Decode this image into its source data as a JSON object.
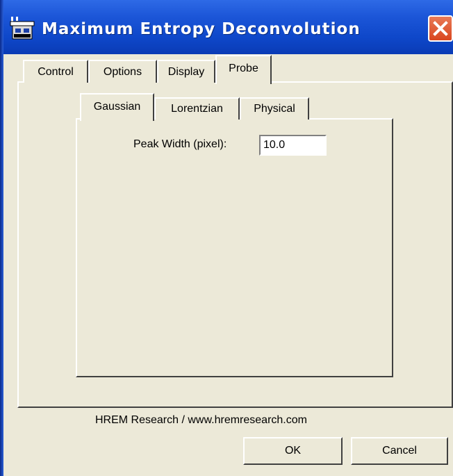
{
  "window": {
    "title": "Maximum Entropy Deconvolution",
    "title_icon": "application-icon",
    "close_icon": "close-icon",
    "titlebar_color": "#0a47c9",
    "close_color": "#d9461f"
  },
  "outer_tabs": [
    {
      "label": "Control",
      "selected": false
    },
    {
      "label": "Options",
      "selected": false
    },
    {
      "label": "Display",
      "selected": false
    },
    {
      "label": "Probe",
      "selected": true
    }
  ],
  "inner_tabs": [
    {
      "label": "Gaussian",
      "selected": true
    },
    {
      "label": "Lorentzian",
      "selected": false
    },
    {
      "label": "Physical",
      "selected": false
    }
  ],
  "gaussian": {
    "peak_width_label": "Peak Width (pixel):",
    "peak_width_value": "10.0"
  },
  "footer": {
    "credit": "HREM Research / www.hremresearch.com",
    "ok_label": "OK",
    "cancel_label": "Cancel"
  }
}
